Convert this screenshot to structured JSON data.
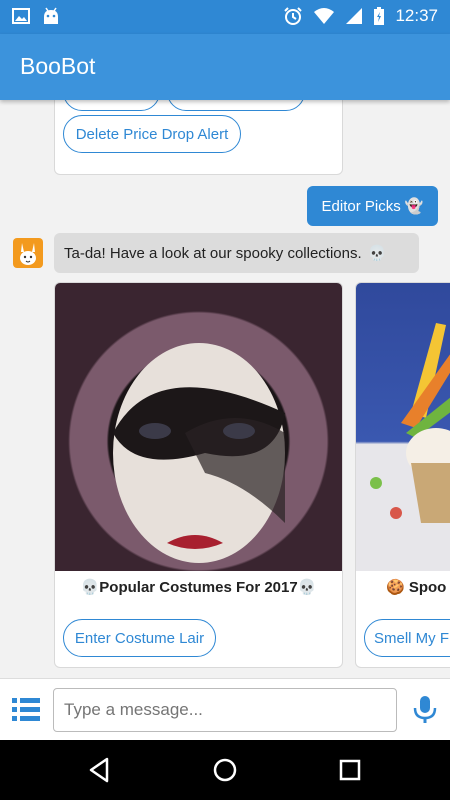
{
  "status_bar": {
    "time": "12:37"
  },
  "app_bar": {
    "title": "BooBot"
  },
  "chat": {
    "previous_card": {
      "button_label": "Delete Price Drop Alert"
    },
    "user_message": {
      "text": "Editor Picks",
      "emoji": "👻"
    },
    "bot_message": {
      "text": "Ta-da! Have a look at our spooky collections.",
      "emoji": "💀"
    },
    "carousel": [
      {
        "title": "💀Popular Costumes For 2017💀",
        "button_label": "Enter Costume Lair"
      },
      {
        "title": "🍪 Spoo",
        "button_label": "Smell My F"
      }
    ]
  },
  "composer": {
    "placeholder": "Type a message..."
  },
  "colors": {
    "primary": "#2f88d4",
    "app_bar": "#3c93dc",
    "avatar": "#f39a1e"
  },
  "icons": [
    "image-icon",
    "android-icon",
    "alarm-icon",
    "wifi-icon",
    "signal-icon",
    "battery-icon",
    "menu-list-icon",
    "mic-icon",
    "back-icon",
    "home-icon",
    "recents-icon"
  ]
}
